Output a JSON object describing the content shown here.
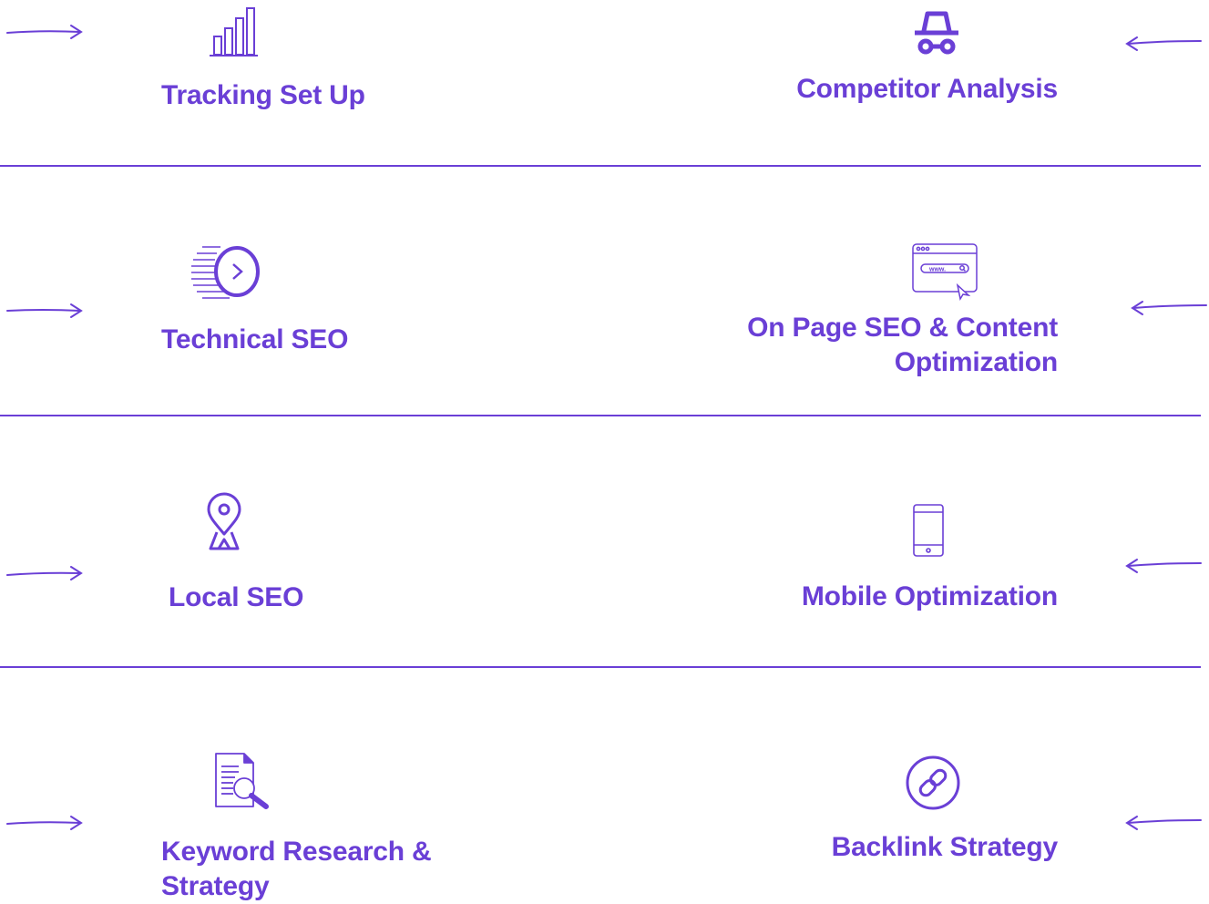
{
  "accent_color": "#6a3fd6",
  "services": [
    {
      "left": {
        "icon": "bar-chart-icon",
        "label": "Tracking Set Up"
      },
      "right": {
        "icon": "incognito-icon",
        "label": "Competitor Analysis"
      }
    },
    {
      "left": {
        "icon": "speed-clock-icon",
        "label": "Technical SEO"
      },
      "right": {
        "icon": "browser-www-icon",
        "label": "On Page SEO & Content Optimization"
      }
    },
    {
      "left": {
        "icon": "map-pin-icon",
        "label": "Local SEO"
      },
      "right": {
        "icon": "smartphone-icon",
        "label": "Mobile Optimization"
      }
    },
    {
      "left": {
        "icon": "document-search-icon",
        "label": "Keyword Research & Strategy"
      },
      "right": {
        "icon": "link-circle-icon",
        "label": "Backlink Strategy"
      }
    }
  ],
  "browser_icon_text": "www.",
  "arrows": {
    "left": "arrow-right-icon",
    "right": "arrow-left-icon"
  }
}
